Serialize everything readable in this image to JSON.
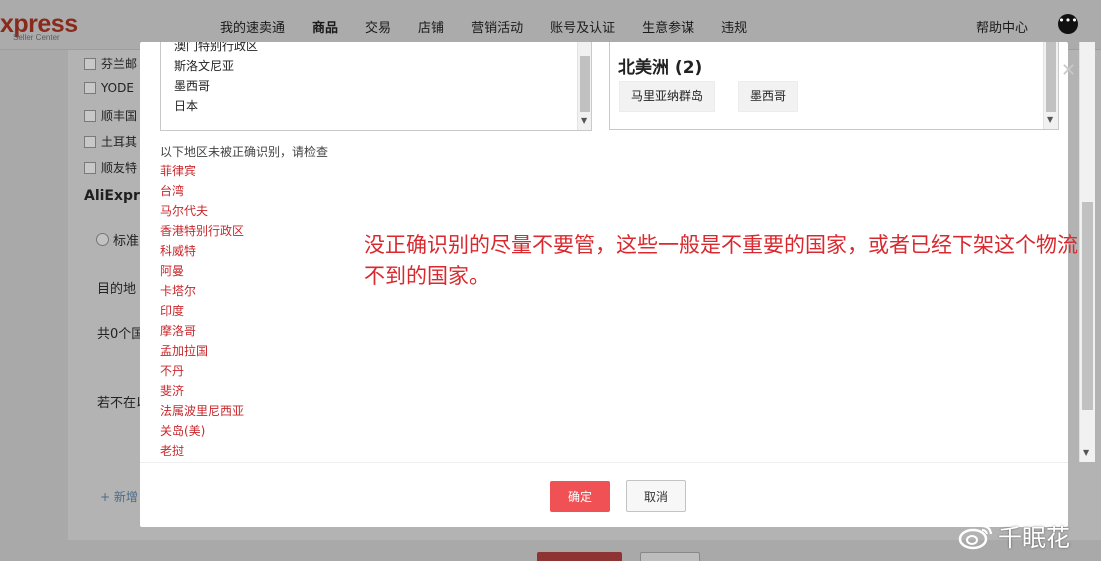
{
  "header": {
    "logo_text": "xpress",
    "logo_sub": "Seller Center",
    "nav": [
      "我的速卖通",
      "商品",
      "交易",
      "店铺",
      "营销活动",
      "账号及认证",
      "生意参谋",
      "违规"
    ],
    "help_center": "帮助中心",
    "chat_icon": "chat-bubble-icon"
  },
  "background": {
    "checkboxes": [
      "芬兰邮",
      "YODE",
      "顺丰国",
      "土耳其",
      "顺友特"
    ],
    "section_title": "AliExpre",
    "radio_label": "标准",
    "dest_label": "目的地",
    "count_text": "共0个国",
    "if_not_text": "若不在以",
    "add_link": "+ 新增"
  },
  "modal": {
    "left_list": [
      "澳门特别行政区",
      "斯洛文尼亚",
      "墨西哥",
      "日本"
    ],
    "region": {
      "title": "北美洲 (2)",
      "tags": [
        "马里亚纳群岛",
        "墨西哥"
      ]
    },
    "hint": "以下地区未被正确识别，请检查",
    "unrecognized": [
      "菲律宾",
      "台湾",
      "马尔代夫",
      "香港特别行政区",
      "科威特",
      "阿曼",
      "卡塔尔",
      "印度",
      "摩洛哥",
      "孟加拉国",
      "不丹",
      "斐济",
      "法属波里尼西亚",
      "关岛(美)",
      "老挝"
    ],
    "annotation": "没正确识别的尽量不要管，这些一般是不重要的国家，或者已经下架这个物流不到的国家。",
    "confirm": "确定",
    "cancel": "取消",
    "close_icon": "close-icon"
  },
  "watermark": {
    "text": "千眠花",
    "icon": "weibo-icon"
  },
  "colors": {
    "confirm_bg": "#f05155",
    "annotation": "#d9282e",
    "unrecognized": "#c8272c"
  }
}
